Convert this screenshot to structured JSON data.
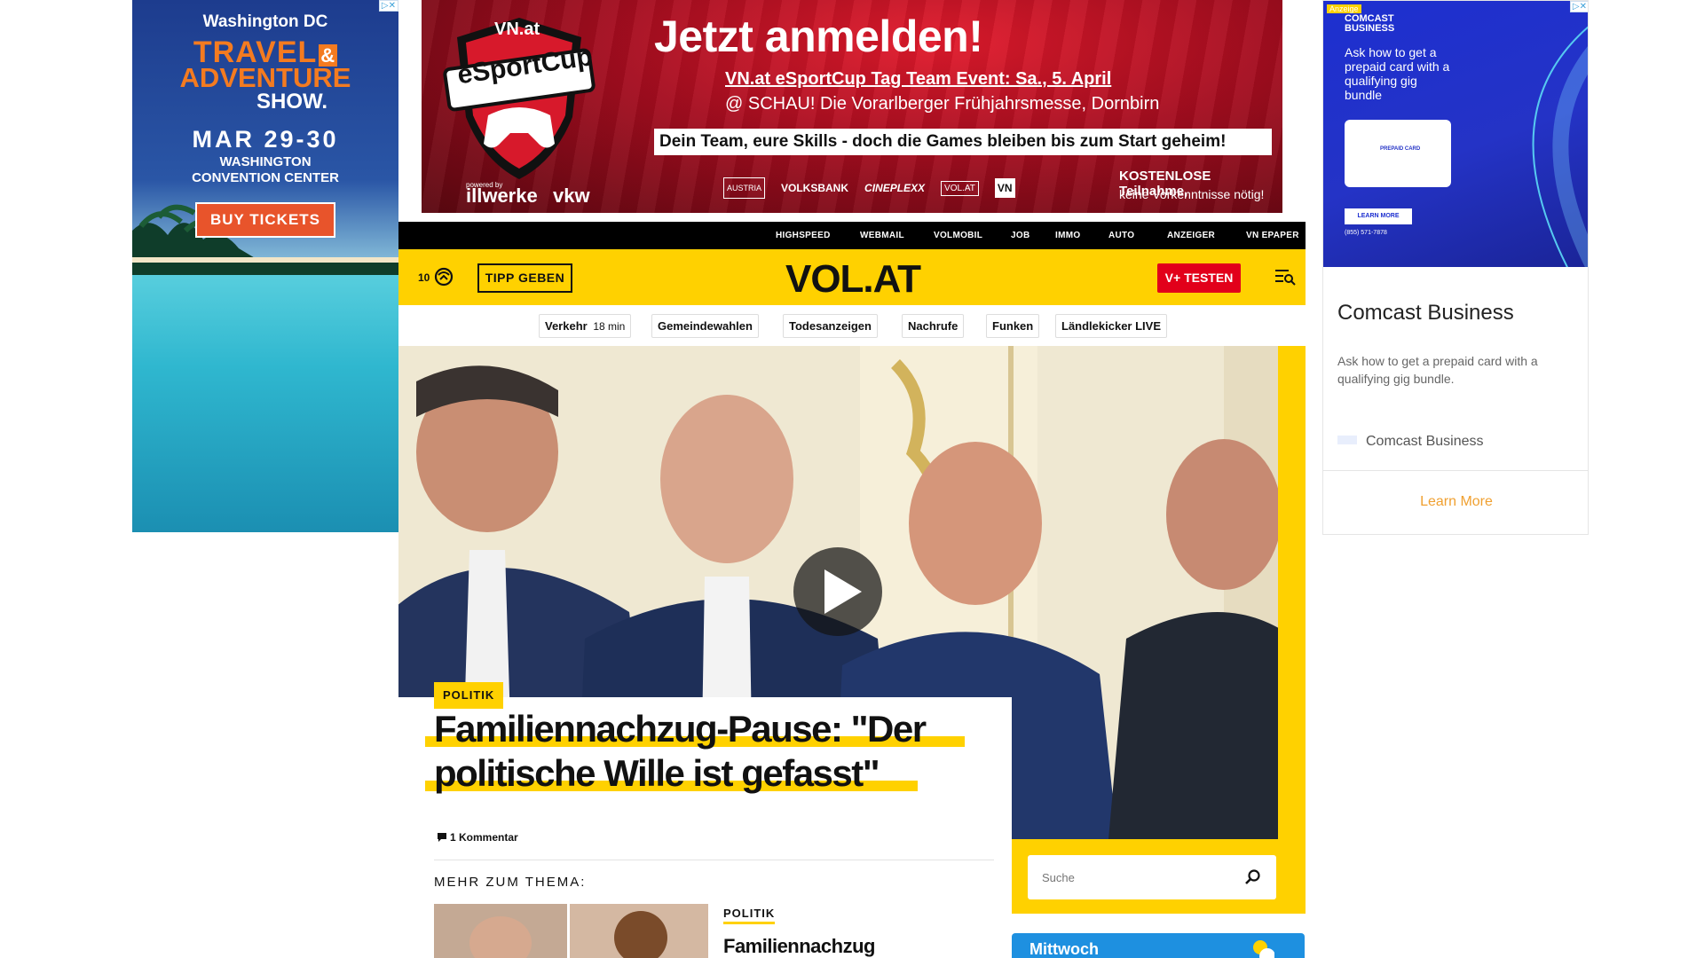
{
  "left_ad": {
    "line1": "Washington DC",
    "line2": "TRAVEL",
    "amp": "&",
    "line3": "ADVENTURE",
    "line4": "SHOW.",
    "dates": "MAR 29-30",
    "venue1": "WASHINGTON",
    "venue2": "CONVENTION CENTER",
    "cta": "BUY TICKETS"
  },
  "top_banner": {
    "brand_top": "VN.at",
    "brand_main": "eSportCup",
    "powered": "powered by",
    "sponsor1": "illwerke",
    "sponsor2": "vkw",
    "headline": "Jetzt anmelden!",
    "line1": "VN.at eSportCup Tag Team Event: Sa., 5. April",
    "line2": "@ SCHAU! Die Vorarlberger Frühjahrsmesse, Dornbirn",
    "line3": "Dein Team, eure Skills - doch die Games bleiben bis zum Start geheim!",
    "logos": [
      "AUSTRIA",
      "VOLKSBANK",
      "CINEPLEXX",
      "VOL.AT",
      "VN"
    ],
    "free1": "KOSTENLOSE Teilnahme,",
    "free2": "keine Vorkenntnisse nötig!"
  },
  "topnav": [
    "HIGHSPEED",
    "WEBMAIL",
    "VOLMOBIL",
    "JOB",
    "IMMO",
    "AUTO",
    "ANZEIGER",
    "VN EPAPER"
  ],
  "brandbar": {
    "temperature": "10",
    "tip_button": "TIPP GEBEN",
    "logo": "VOL.AT",
    "vplus_button": "V+ TESTEN",
    "menu_icon": "menu-search-icon"
  },
  "categories": [
    {
      "label": "Verkehr",
      "extra": "18 min"
    },
    {
      "label": "Gemeindewahlen"
    },
    {
      "label": "Todesanzeigen"
    },
    {
      "label": "Nachrufe"
    },
    {
      "label": "Funken"
    },
    {
      "label": "Ländlekicker LIVE"
    }
  ],
  "article": {
    "category": "POLITIK",
    "title_line1": "Familiennachzug-Pause: \"Der",
    "title_line2": "politische Wille ist gefasst\"",
    "comments": "1 Kommentar",
    "more_heading": "MEHR ZUM THEMA:",
    "related_category": "POLITIK",
    "related_title": "Familiennachzug"
  },
  "search": {
    "placeholder": "Suche"
  },
  "weather_card": {
    "day": "Mittwoch"
  },
  "right_ad": {
    "badge": "Anzeige",
    "brand_small_1": "COMCAST",
    "brand_small_2": "BUSINESS",
    "pitch": "Ask how to get a prepaid card with a qualifying gig bundle",
    "card_label": "PREPAID CARD",
    "learn_small": "LEARN MORE",
    "phone": "(855) 571-7878",
    "title": "Comcast Business",
    "body": "Ask how to get a prepaid card with a qualifying gig bundle.",
    "advertiser": "Comcast Business",
    "cta": "Learn More"
  },
  "colors": {
    "brand_yellow": "#ffd100",
    "vplus_red": "#e2001a",
    "black": "#000000"
  }
}
